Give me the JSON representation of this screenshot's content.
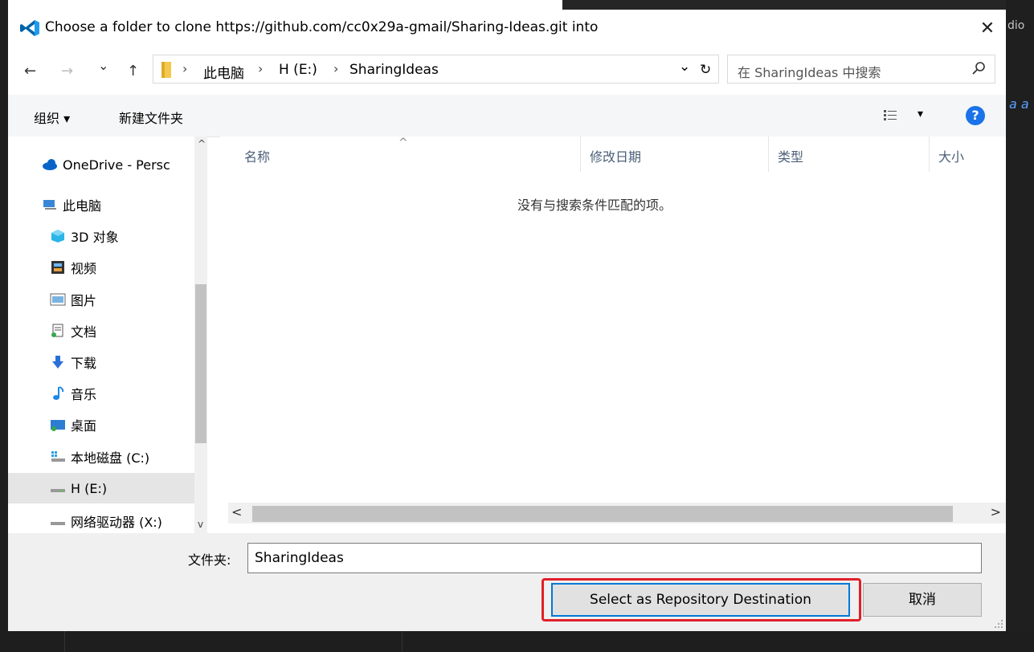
{
  "background": {
    "right_edge_text": "dio",
    "right_edge_italic": "a a"
  },
  "dialog": {
    "title": "Choose a folder to clone https://github.com/cc0x29a-gmail/Sharing-Ideas.git into",
    "close_glyph": "✕"
  },
  "nav": {
    "back": "←",
    "forward": "→",
    "recent": "⌄",
    "up": "↑"
  },
  "address": {
    "crumbs": [
      "此电脑",
      "H (E:)",
      "SharingIdeas"
    ],
    "separator": "›",
    "dropdown": "⌄",
    "refresh": "↻"
  },
  "search": {
    "placeholder": "在 SharingIdeas 中搜索"
  },
  "toolbar": {
    "organize": "组织 ▾",
    "new_folder": "新建文件夹",
    "view_dropdown": "▾",
    "help": "?"
  },
  "sidebar": {
    "items": [
      {
        "label": "OneDrive - Persc",
        "icon": "cloud-icon"
      },
      {
        "label": "此电脑",
        "icon": "computer-icon"
      },
      {
        "label": "3D 对象",
        "icon": "cube-icon"
      },
      {
        "label": "视频",
        "icon": "video-icon"
      },
      {
        "label": "图片",
        "icon": "picture-icon"
      },
      {
        "label": "文档",
        "icon": "document-icon"
      },
      {
        "label": "下载",
        "icon": "download-icon"
      },
      {
        "label": "音乐",
        "icon": "music-icon"
      },
      {
        "label": "桌面",
        "icon": "desktop-icon"
      },
      {
        "label": "本地磁盘 (C:)",
        "icon": "drive-icon"
      },
      {
        "label": "H (E:)",
        "icon": "drive-icon",
        "selected": true
      },
      {
        "label": "网络驱动器 (X:)",
        "icon": "network-drive-icon"
      }
    ],
    "scroll_up": "^",
    "scroll_down": "v"
  },
  "files": {
    "columns": [
      "名称",
      "修改日期",
      "类型",
      "大小"
    ],
    "sort_indicator": "^",
    "empty_message": "没有与搜索条件匹配的项。",
    "scroll_left": "<",
    "scroll_right": ">"
  },
  "footer": {
    "folder_label": "文件夹:",
    "folder_value": "SharingIdeas",
    "select_button": "Select as Repository Destination",
    "cancel_button": "取消"
  },
  "colors": {
    "accent": "#0078d7",
    "highlight_outline": "#e0202a",
    "help": "#1a73e8",
    "vscode_blue": "#0065a9"
  }
}
